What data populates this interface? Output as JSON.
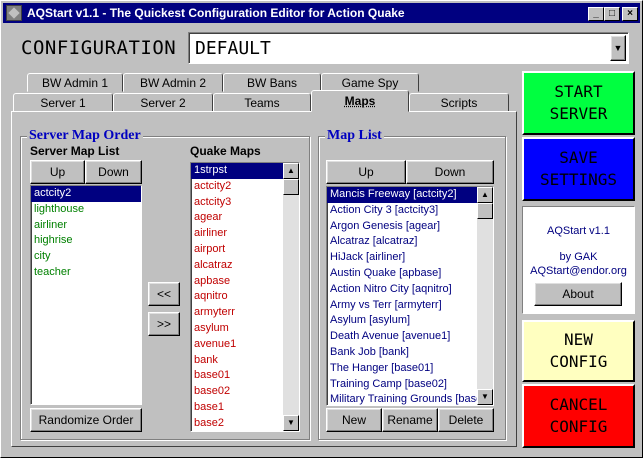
{
  "window": {
    "title": "AQStart v1.1 - The Quickest Configuration Editor for Action Quake",
    "minimize": "_",
    "maximize": "□",
    "close": "×"
  },
  "config": {
    "label": "CONFIGURATION",
    "value": "DEFAULT",
    "dropdown_glyph": "▼"
  },
  "tabs_back": [
    "BW Admin 1",
    "BW Admin 2",
    "BW Bans",
    "Game Spy"
  ],
  "tabs_front": [
    "Server 1",
    "Server 2",
    "Teams",
    "Maps",
    "Scripts"
  ],
  "server_map_order": {
    "title": "Server Map Order",
    "list_label": "Server Map List",
    "up": "Up",
    "down": "Down",
    "items": [
      "actcity2",
      "lighthouse",
      "airliner",
      "highrise",
      "city",
      "teacher"
    ],
    "selected_index": 0,
    "randomize": "Randomize Order"
  },
  "transfer": {
    "add": "<<",
    "remove": ">>"
  },
  "quake_maps": {
    "label": "Quake Maps",
    "items": [
      "1strpst",
      "actcity2",
      "actcity3",
      "agear",
      "airliner",
      "airport",
      "alcatraz",
      "apbase",
      "aqnitro",
      "armyterr",
      "asylum",
      "avenue1",
      "bank",
      "base01",
      "base02",
      "base1",
      "base2"
    ],
    "selected_index": 0
  },
  "map_list": {
    "title": "Map List",
    "up": "Up",
    "down": "Down",
    "items": [
      "Mancis Freeway [actcity2]",
      "Action City 3 [actcity3]",
      "Argon Genesis [agear]",
      "Alcatraz [alcatraz]",
      "HiJack [airliner]",
      "Austin Quake [apbase]",
      "Action Nitro City [aqnitro]",
      "Army vs Terr [armyterr]",
      "Asylum [asylum]",
      "Death Avenue [avenue1]",
      "Bank Job [bank]",
      "The Hanger [base01]",
      "Training Camp [base02]",
      "Military Training Grounds [base"
    ],
    "selected_index": 0,
    "new": "New",
    "rename": "Rename",
    "delete": "Delete"
  },
  "actions": {
    "start": "START\nSERVER",
    "save": "SAVE\nSETTINGS",
    "new_config": "NEW\nCONFIG",
    "cancel_config": "CANCEL\nCONFIG"
  },
  "about": {
    "app": "AQStart v1.1",
    "by": "by GAK",
    "email": "AQStart@endor.org",
    "button": "About"
  },
  "colors": {
    "start": "#00ff40",
    "save": "#0000ff",
    "new_config": "#ffffc0",
    "cancel_config": "#ff0000"
  }
}
